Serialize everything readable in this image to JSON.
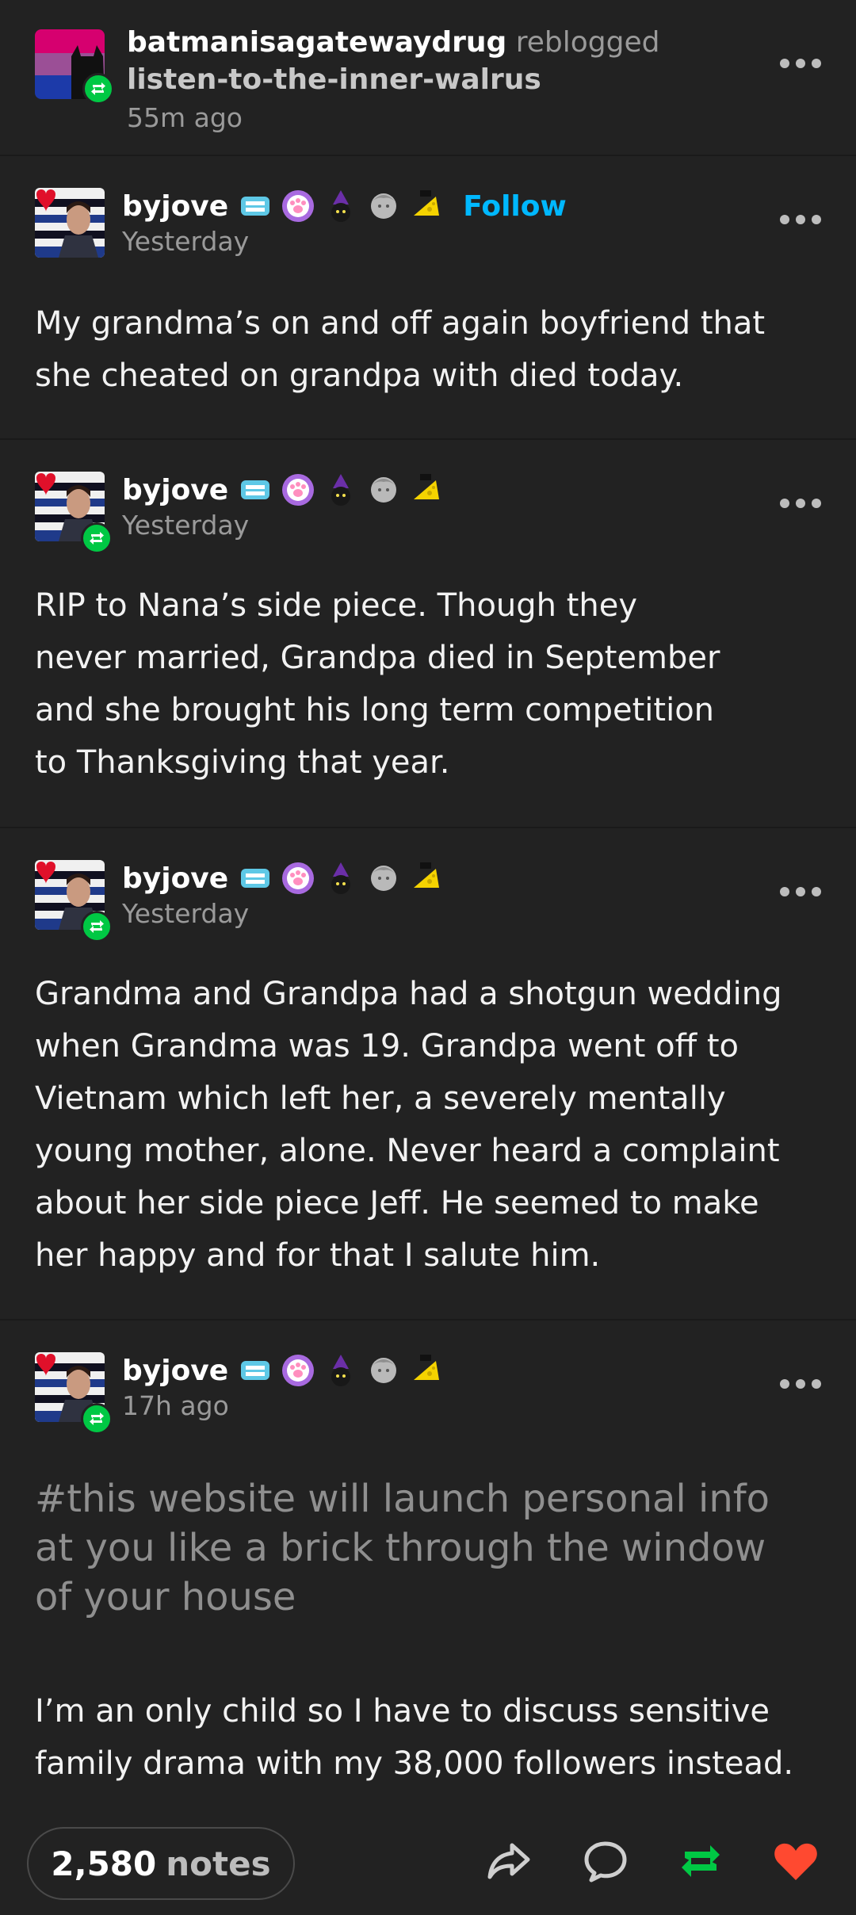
{
  "header": {
    "username": "batmanisagatewaydrug",
    "verb": "reblogged",
    "from": "listen-to-the-inner-walrus",
    "time": "55m ago"
  },
  "trail": [
    {
      "username": "byjove",
      "follow": "Follow",
      "time": "Yesterday",
      "paragraphs": [
        "My grandma’s on and off again boyfriend that she cheated on grandpa with died today."
      ]
    },
    {
      "username": "byjove",
      "time": "Yesterday",
      "paragraphs": [
        "RIP to Nana’s side piece. Though they never married, Grandpa died in September and she brought his long term competition to Thanksgiving that year."
      ]
    },
    {
      "username": "byjove",
      "time": "Yesterday",
      "paragraphs": [
        "Grandma and Grandpa had a shotgun wedding when Grandma was 19. Grandpa went off to Vietnam which left her, a severely mentally young mother, alone. Never heard a complaint about her side piece Jeff. He seemed to make her happy and for that I salute him."
      ]
    },
    {
      "username": "byjove",
      "time": "17h ago",
      "tags": "#this website will launch personal info at you like a brick through the window of your house",
      "paragraphs": [
        "I’m an only child so I have to discuss sensitive family drama with my 38,000 followers instead."
      ]
    }
  ],
  "badges": [
    "teeth-badge-icon",
    "paw-badge-icon",
    "witch-cat-badge-icon",
    "statue-head-badge-icon",
    "cheese-badge-icon"
  ],
  "footer": {
    "notes_count": "2,580",
    "notes_label": "notes"
  },
  "colors": {
    "background": "#222222",
    "follow": "#00b8ff",
    "reblog_green": "#00c844",
    "like_red": "#ff4930"
  }
}
